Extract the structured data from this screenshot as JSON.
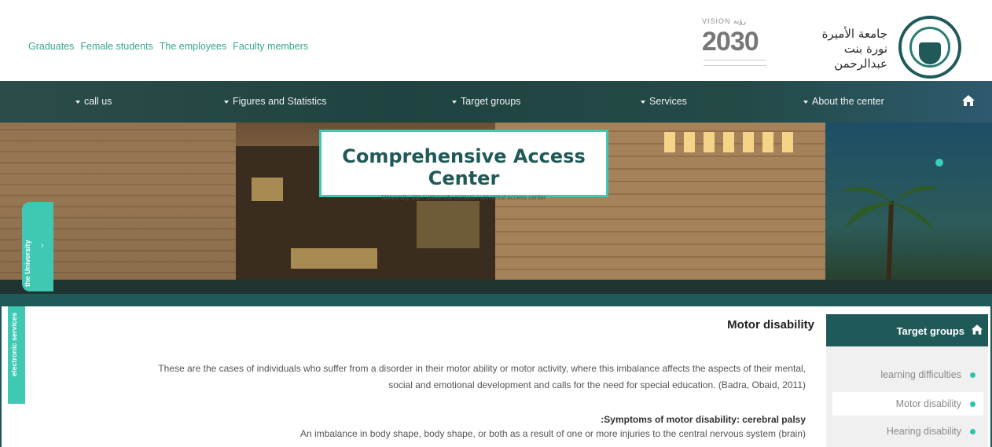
{
  "header": {
    "links": [
      "Graduates",
      "Female students",
      "The employees",
      "Faculty members"
    ],
    "vision_logo": {
      "top_text": "VISION رؤية",
      "year": "2030"
    },
    "university_name_line1": "جامعة الأميرة",
    "university_name_line2": "نورة بنت عبدالرحمن"
  },
  "nav": {
    "items": [
      "call us",
      "Figures and Statistics",
      "Target groups",
      "Services",
      "About the center"
    ],
    "home_icon": "home-icon"
  },
  "hero": {
    "title": "Comprehensive Access Center",
    "breadcrumb": "University site / university centers / universal access center",
    "side_tab": "the University"
  },
  "side_tabs": {
    "electronic_services": "electronic services"
  },
  "content": {
    "title": "Motor disability",
    "paragraph": "These are the cases of individuals who suffer from a disorder in their motor ability or motor activity, where this imbalance affects the aspects of their mental, social and emotional development and calls for the need for special education. (Badra, Obaid, 2011)",
    "subheading": ":Symptoms of motor disability: cerebral palsy",
    "paragraph2": "An imbalance in body shape, body shape, or both as a result of one or more injuries to the central nervous system (brain)"
  },
  "sidebar": {
    "heading": "Target groups",
    "items": [
      {
        "label": "learning difficulties",
        "active": false
      },
      {
        "label": "Motor disability",
        "active": true
      },
      {
        "label": "Hearing disability",
        "active": false
      }
    ]
  },
  "colors": {
    "primary": "#1f5a58",
    "accent": "#3fc9b5",
    "link": "#3aa58f"
  }
}
